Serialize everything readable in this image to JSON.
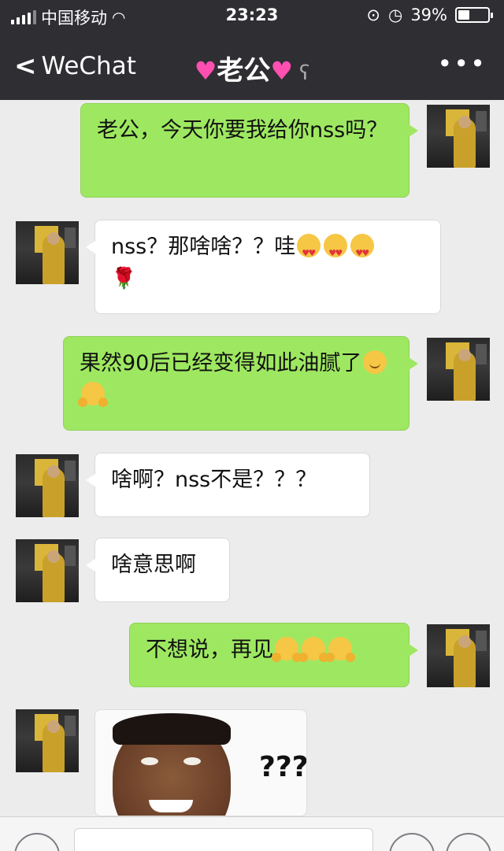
{
  "status_bar": {
    "carrier": "中国移动",
    "time": "23:23",
    "battery": "39%",
    "battery_level": 0.39
  },
  "nav": {
    "back_label": "WeChat",
    "contact_name": "老公",
    "more_label": "•••"
  },
  "messages": [
    {
      "side": "me",
      "text": "老公，今天你要我给你nss吗？"
    },
    {
      "side": "other",
      "text": "nss？那啥啥？？哇",
      "emoji": [
        "heart-eyes",
        "heart-eyes",
        "heart-eyes"
      ],
      "trailing": "🌹"
    },
    {
      "side": "me",
      "text": "果然90后已经变得如此油腻了",
      "emoji": [
        "smile",
        "hug"
      ]
    },
    {
      "side": "other",
      "text": "啥啊？nss不是？？？"
    },
    {
      "side": "other",
      "text": "啥意思啊"
    },
    {
      "side": "me",
      "text": "不想说，再见",
      "emoji": [
        "hug",
        "hug",
        "hug"
      ]
    },
    {
      "side": "other",
      "type": "sticker",
      "sticker_text": "???"
    }
  ],
  "colors": {
    "nav_bg": "#2e2e33",
    "chat_bg": "#ececec",
    "me_bubble": "#9ee861",
    "other_bubble": "#ffffff"
  }
}
